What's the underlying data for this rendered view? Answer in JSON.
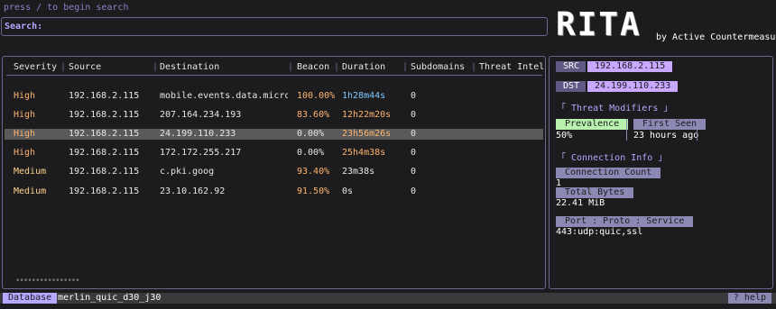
{
  "search": {
    "hint": "press / to begin search",
    "label": "Search:",
    "value": ""
  },
  "brand": {
    "logo": "RITA",
    "byline": "by Active Countermeasures©"
  },
  "table": {
    "headers": [
      "Severity",
      "Source",
      "Destination",
      "Beacon",
      "Duration",
      "Subdomains",
      "Threat Intel"
    ],
    "rows": [
      {
        "severity": "High",
        "source": "192.168.2.115",
        "destination": "mobile.events.data.microso…",
        "beacon": "100.00%",
        "duration": "1h28m44s",
        "subdomains": "0",
        "threat": ""
      },
      {
        "severity": "High",
        "source": "192.168.2.115",
        "destination": "207.164.234.193",
        "beacon": "83.60%",
        "duration": "12h22m20s",
        "subdomains": "0",
        "threat": ""
      },
      {
        "severity": "High",
        "source": "192.168.2.115",
        "destination": "24.199.110.233",
        "beacon": "0.00%",
        "duration": "23h56m26s",
        "subdomains": "0",
        "threat": ""
      },
      {
        "severity": "High",
        "source": "192.168.2.115",
        "destination": "172.172.255.217",
        "beacon": "0.00%",
        "duration": "25h4m38s",
        "subdomains": "0",
        "threat": ""
      },
      {
        "severity": "Medium",
        "source": "192.168.2.115",
        "destination": "c.pki.goog",
        "beacon": "93.40%",
        "duration": "23m38s",
        "subdomains": "0",
        "threat": ""
      },
      {
        "severity": "Medium",
        "source": "192.168.2.115",
        "destination": "23.10.162.92",
        "beacon": "91.50%",
        "duration": "0s",
        "subdomains": "0",
        "threat": ""
      }
    ],
    "scroll_indicator": "••••••••••••••••"
  },
  "detail": {
    "src_label": "SRC",
    "src_value": "192.168.2.115",
    "dst_label": "DST",
    "dst_value": "24.199.110.233",
    "threat_modifiers_title": "「 Threat Modifiers 」",
    "prevalence_label": "Prevalence",
    "prevalence_value": "50%",
    "first_seen_label": "First Seen",
    "first_seen_value": "23 hours ago",
    "connection_info_title": "「 Connection Info 」",
    "connection_count_label": "Connection Count",
    "connection_count_value": "1",
    "total_bytes_label": "Total Bytes",
    "total_bytes_value": "22.41 MiB",
    "port_label": "Port : Proto : Service",
    "port_value": "443:udp:quic,ssl"
  },
  "footer": {
    "db_label": "Database",
    "db_name": "merlin_quic_d30_j30",
    "help": "? help"
  },
  "colors": {
    "high": "#ffb46e",
    "medium": "#ffd28a",
    "beacon_high": "#ffb46e",
    "duration_blue": "#7ec8ff",
    "duration_orange": "#ffb46e",
    "accent": "#b7a8ff"
  }
}
